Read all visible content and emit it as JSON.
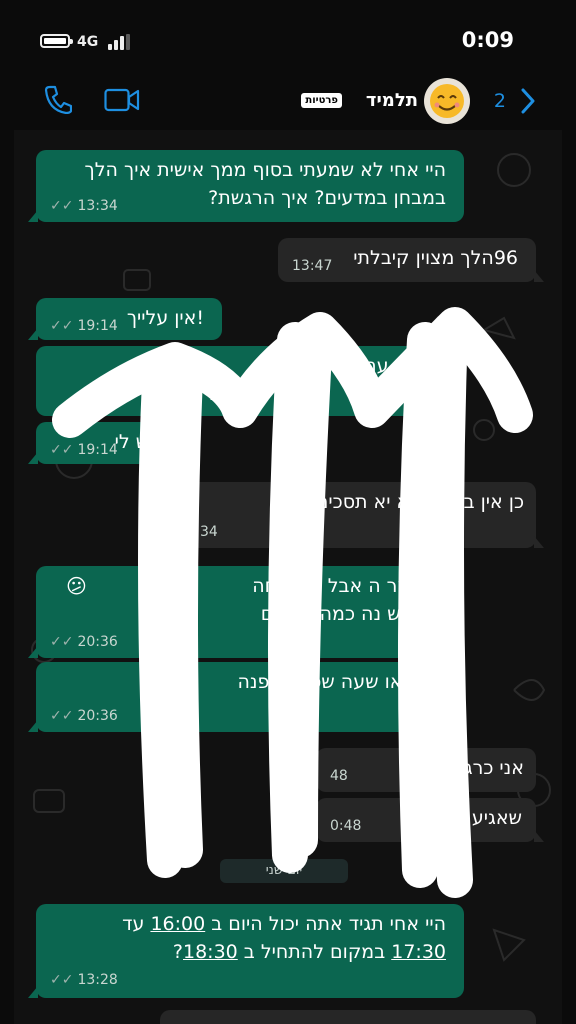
{
  "status_bar": {
    "network": "4G",
    "time": "0:09"
  },
  "header": {
    "contact_name": "תלמיד",
    "badge": "פרטיות",
    "unread_count": "2",
    "icons": {
      "call": "phone-icon",
      "video": "video-camera-icon",
      "back": "chevron-right-icon",
      "avatar": "smiley-avatar"
    },
    "accent_color": "#1e8fe1"
  },
  "messages": [
    {
      "dir": "out",
      "lines": [
        "היי אחי לא שמעתי בסוף ממך אישית איך הלך",
        "במבחן במדעים? איך הרגשת?"
      ],
      "time": "13:34"
    },
    {
      "dir": "in",
      "lines": [
        "96הלך מצוין קיבלתי"
      ],
      "time": "13:47"
    },
    {
      "dir": "out",
      "lines": [
        "!אין עלייך"
      ],
      "time": "19:14"
    },
    {
      "dir": "out",
      "lines": [
        "ב היום עם אמא",
        "ר"
      ],
      "time": ""
    },
    {
      "dir": "out",
      "lines": [
        "זה ממש לי"
      ],
      "time": "19:14"
    },
    {
      "dir": "in",
      "lines": [
        "כן אין בע לאמא יא תסכים"
      ],
      "time": "34"
    },
    {
      "dir": "out",
      "lines": [
        "יא אמר ה אבל לי שכחה",
        "ש שתש נה כמה ד ושום"
      ],
      "time": "20:36",
      "emoji": "😕"
    },
    {
      "dir": "out",
      "lines": [
        "עדכן או שעה שס לי תפנה"
      ],
      "time": "20:36"
    },
    {
      "dir": "in",
      "lines": [
        "אני כרג בית"
      ],
      "time": "48"
    },
    {
      "dir": "in",
      "lines": [
        "שאגיע זה"
      ],
      "time": "0:48"
    },
    {
      "dir": "out",
      "lines": [
        "עד 16:00 היי אחי תגיד אתה יכול היום ב",
        "?18:30 במקום להתחיל ב 17:30"
      ],
      "time": "13:28"
    }
  ],
  "day_separator": "יום שני",
  "last_msg_line1": {
    "pre": "היי אחי תגיד אתה יכול היום ב ",
    "t1": "16:00",
    "post": " עד"
  },
  "last_msg_line2": {
    "t2": "17:30",
    "mid": " במקום להתחיל ב ",
    "t3": "18:30",
    "end": "?"
  },
  "colors": {
    "outgoing_bubble": "#0b6650",
    "incoming_bubble": "#262626",
    "scribble": "#ffffff"
  }
}
